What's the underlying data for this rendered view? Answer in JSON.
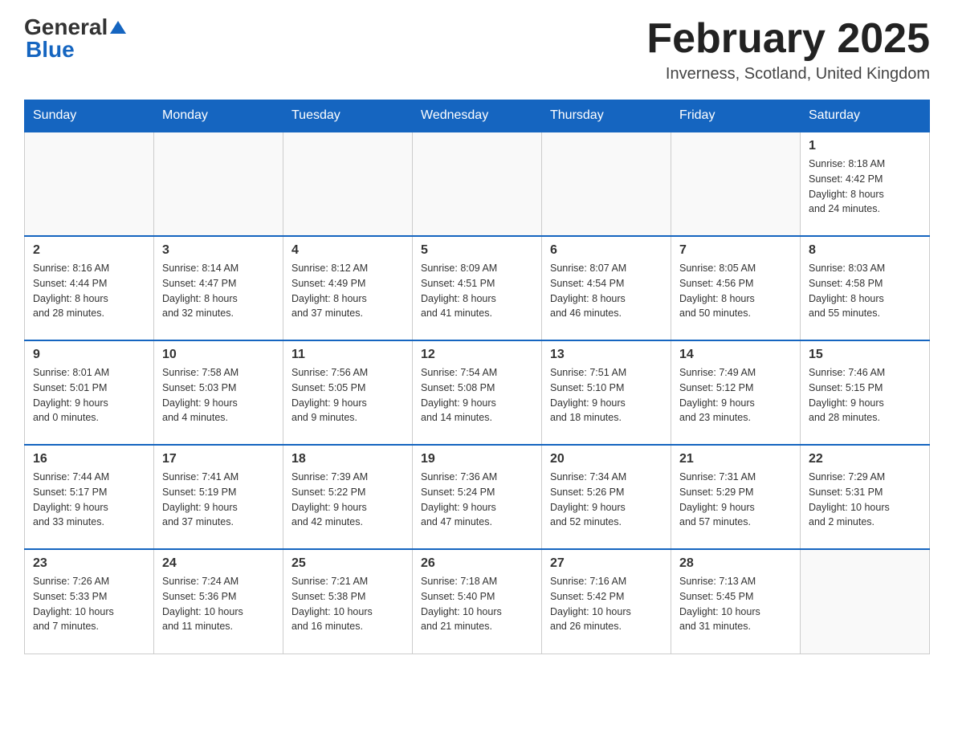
{
  "header": {
    "logo_general": "General",
    "logo_blue": "Blue",
    "month_title": "February 2025",
    "subtitle": "Inverness, Scotland, United Kingdom"
  },
  "weekdays": [
    "Sunday",
    "Monday",
    "Tuesday",
    "Wednesday",
    "Thursday",
    "Friday",
    "Saturday"
  ],
  "weeks": [
    [
      {
        "day": "",
        "info": ""
      },
      {
        "day": "",
        "info": ""
      },
      {
        "day": "",
        "info": ""
      },
      {
        "day": "",
        "info": ""
      },
      {
        "day": "",
        "info": ""
      },
      {
        "day": "",
        "info": ""
      },
      {
        "day": "1",
        "info": "Sunrise: 8:18 AM\nSunset: 4:42 PM\nDaylight: 8 hours\nand 24 minutes."
      }
    ],
    [
      {
        "day": "2",
        "info": "Sunrise: 8:16 AM\nSunset: 4:44 PM\nDaylight: 8 hours\nand 28 minutes."
      },
      {
        "day": "3",
        "info": "Sunrise: 8:14 AM\nSunset: 4:47 PM\nDaylight: 8 hours\nand 32 minutes."
      },
      {
        "day": "4",
        "info": "Sunrise: 8:12 AM\nSunset: 4:49 PM\nDaylight: 8 hours\nand 37 minutes."
      },
      {
        "day": "5",
        "info": "Sunrise: 8:09 AM\nSunset: 4:51 PM\nDaylight: 8 hours\nand 41 minutes."
      },
      {
        "day": "6",
        "info": "Sunrise: 8:07 AM\nSunset: 4:54 PM\nDaylight: 8 hours\nand 46 minutes."
      },
      {
        "day": "7",
        "info": "Sunrise: 8:05 AM\nSunset: 4:56 PM\nDaylight: 8 hours\nand 50 minutes."
      },
      {
        "day": "8",
        "info": "Sunrise: 8:03 AM\nSunset: 4:58 PM\nDaylight: 8 hours\nand 55 minutes."
      }
    ],
    [
      {
        "day": "9",
        "info": "Sunrise: 8:01 AM\nSunset: 5:01 PM\nDaylight: 9 hours\nand 0 minutes."
      },
      {
        "day": "10",
        "info": "Sunrise: 7:58 AM\nSunset: 5:03 PM\nDaylight: 9 hours\nand 4 minutes."
      },
      {
        "day": "11",
        "info": "Sunrise: 7:56 AM\nSunset: 5:05 PM\nDaylight: 9 hours\nand 9 minutes."
      },
      {
        "day": "12",
        "info": "Sunrise: 7:54 AM\nSunset: 5:08 PM\nDaylight: 9 hours\nand 14 minutes."
      },
      {
        "day": "13",
        "info": "Sunrise: 7:51 AM\nSunset: 5:10 PM\nDaylight: 9 hours\nand 18 minutes."
      },
      {
        "day": "14",
        "info": "Sunrise: 7:49 AM\nSunset: 5:12 PM\nDaylight: 9 hours\nand 23 minutes."
      },
      {
        "day": "15",
        "info": "Sunrise: 7:46 AM\nSunset: 5:15 PM\nDaylight: 9 hours\nand 28 minutes."
      }
    ],
    [
      {
        "day": "16",
        "info": "Sunrise: 7:44 AM\nSunset: 5:17 PM\nDaylight: 9 hours\nand 33 minutes."
      },
      {
        "day": "17",
        "info": "Sunrise: 7:41 AM\nSunset: 5:19 PM\nDaylight: 9 hours\nand 37 minutes."
      },
      {
        "day": "18",
        "info": "Sunrise: 7:39 AM\nSunset: 5:22 PM\nDaylight: 9 hours\nand 42 minutes."
      },
      {
        "day": "19",
        "info": "Sunrise: 7:36 AM\nSunset: 5:24 PM\nDaylight: 9 hours\nand 47 minutes."
      },
      {
        "day": "20",
        "info": "Sunrise: 7:34 AM\nSunset: 5:26 PM\nDaylight: 9 hours\nand 52 minutes."
      },
      {
        "day": "21",
        "info": "Sunrise: 7:31 AM\nSunset: 5:29 PM\nDaylight: 9 hours\nand 57 minutes."
      },
      {
        "day": "22",
        "info": "Sunrise: 7:29 AM\nSunset: 5:31 PM\nDaylight: 10 hours\nand 2 minutes."
      }
    ],
    [
      {
        "day": "23",
        "info": "Sunrise: 7:26 AM\nSunset: 5:33 PM\nDaylight: 10 hours\nand 7 minutes."
      },
      {
        "day": "24",
        "info": "Sunrise: 7:24 AM\nSunset: 5:36 PM\nDaylight: 10 hours\nand 11 minutes."
      },
      {
        "day": "25",
        "info": "Sunrise: 7:21 AM\nSunset: 5:38 PM\nDaylight: 10 hours\nand 16 minutes."
      },
      {
        "day": "26",
        "info": "Sunrise: 7:18 AM\nSunset: 5:40 PM\nDaylight: 10 hours\nand 21 minutes."
      },
      {
        "day": "27",
        "info": "Sunrise: 7:16 AM\nSunset: 5:42 PM\nDaylight: 10 hours\nand 26 minutes."
      },
      {
        "day": "28",
        "info": "Sunrise: 7:13 AM\nSunset: 5:45 PM\nDaylight: 10 hours\nand 31 minutes."
      },
      {
        "day": "",
        "info": ""
      }
    ]
  ]
}
